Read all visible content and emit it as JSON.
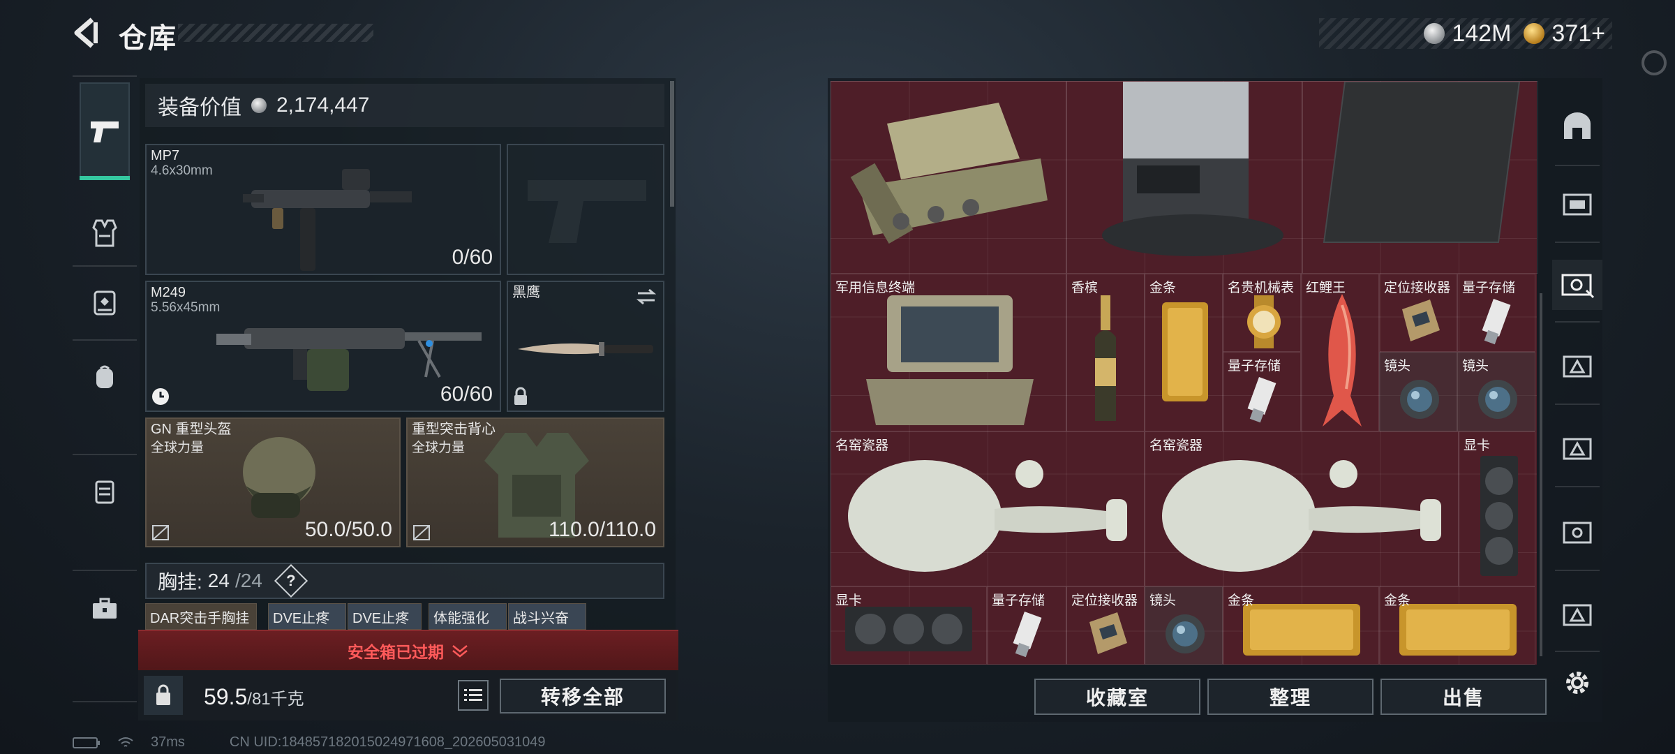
{
  "header": {
    "title": "仓库",
    "currency_silver": "142M",
    "currency_gold": "371+"
  },
  "equipment": {
    "value_label": "装备价值",
    "value": "2,174,447",
    "primary": {
      "name": "MP7",
      "caliber": "4.6x30mm",
      "ammo": "0/60"
    },
    "secondary": {
      "name": "M249",
      "caliber": "5.56x45mm",
      "ammo": "60/60"
    },
    "melee": {
      "name": "黑鹰"
    },
    "helmet": {
      "name": "GN 重型头盔",
      "faction": "全球力量",
      "durability": "50.0/50.0"
    },
    "armor": {
      "name": "重型突击背心",
      "faction": "全球力量",
      "durability": "110.0/110.0"
    },
    "rig": {
      "label": "胸挂:",
      "used": "24",
      "capacity": "/24",
      "help": "?"
    },
    "rig_items": [
      "DAR突击手胸挂",
      "DVE止疼片",
      "DVE止疼片",
      "体能强化剂",
      "战斗兴奋剂"
    ],
    "safe_box_expired": "安全箱已过期",
    "weight": {
      "current": "59.5",
      "max": "/81千克"
    },
    "transfer_all": "转移全部"
  },
  "stash": {
    "items": [
      {
        "id": "terminal",
        "label": "军用信息终端"
      },
      {
        "id": "champagne",
        "label": "香槟"
      },
      {
        "id": "gold1",
        "label": "金条"
      },
      {
        "id": "watch",
        "label": "名贵机械表"
      },
      {
        "id": "koi",
        "label": "红鲤王"
      },
      {
        "id": "locator1",
        "label": "定位接收器"
      },
      {
        "id": "quantum1",
        "label": "量子存储"
      },
      {
        "id": "quantum2",
        "label": "量子存储"
      },
      {
        "id": "lens1",
        "label": "镜头"
      },
      {
        "id": "lens2",
        "label": "镜头"
      },
      {
        "id": "vase1",
        "label": "名窑瓷器"
      },
      {
        "id": "vase2",
        "label": "名窑瓷器"
      },
      {
        "id": "gpu1",
        "label": "显卡"
      },
      {
        "id": "gpu2",
        "label": "显卡"
      },
      {
        "id": "quantum3",
        "label": "量子存储"
      },
      {
        "id": "locator2",
        "label": "定位接收器"
      },
      {
        "id": "lens3",
        "label": "镜头"
      },
      {
        "id": "gold2",
        "label": "金条"
      },
      {
        "id": "gold3",
        "label": "金条"
      }
    ],
    "buttons": {
      "collection": "收藏室",
      "organize": "整理",
      "sell": "出售"
    }
  },
  "status": {
    "ping": "37ms",
    "uid": "CN UID:18485718201502497160‌8_202605031049"
  },
  "colors": {
    "stash_bg": "#4e1e28",
    "accent": "#35c8a0",
    "warning": "#ff5a5a"
  }
}
